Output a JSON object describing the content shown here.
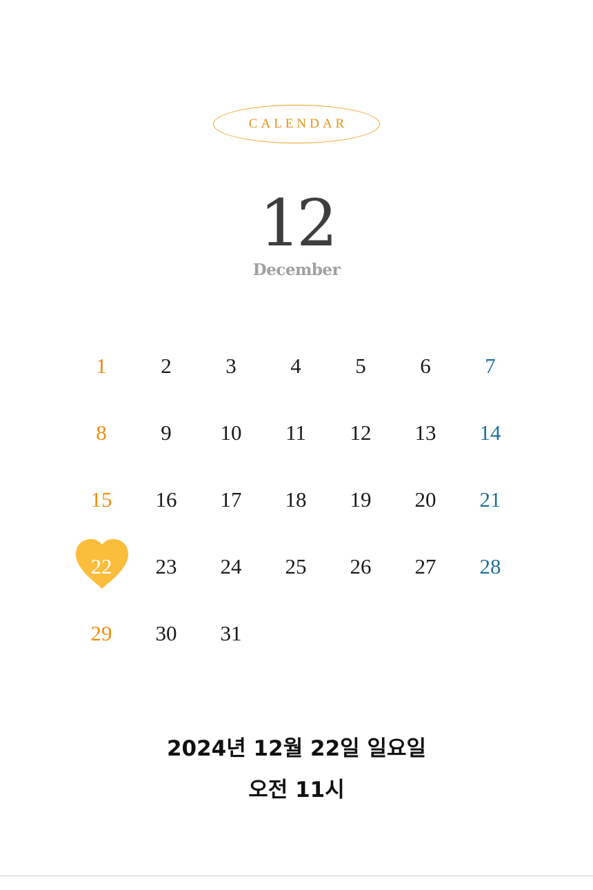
{
  "header": {
    "badge_label": "CALENDAR",
    "month_number": "12",
    "month_name": "December"
  },
  "calendar": {
    "rows": [
      [
        "1",
        "2",
        "3",
        "4",
        "5",
        "6",
        "7"
      ],
      [
        "8",
        "9",
        "10",
        "11",
        "12",
        "13",
        "14"
      ],
      [
        "15",
        "16",
        "17",
        "18",
        "19",
        "20",
        "21"
      ],
      [
        "22",
        "23",
        "24",
        "25",
        "26",
        "27",
        "28"
      ],
      [
        "29",
        "30",
        "31"
      ]
    ],
    "highlighted_day": "22",
    "highlight_icon": "heart-icon"
  },
  "event": {
    "date_line": "2024년 12월 22일 일요일",
    "time_line": "오전 11시"
  },
  "colors": {
    "accent": "#f0a020",
    "sunday": "#f08c10",
    "saturday": "#1f6f9c",
    "heart": "#fbbd3c",
    "text": "#1a1a1a"
  }
}
